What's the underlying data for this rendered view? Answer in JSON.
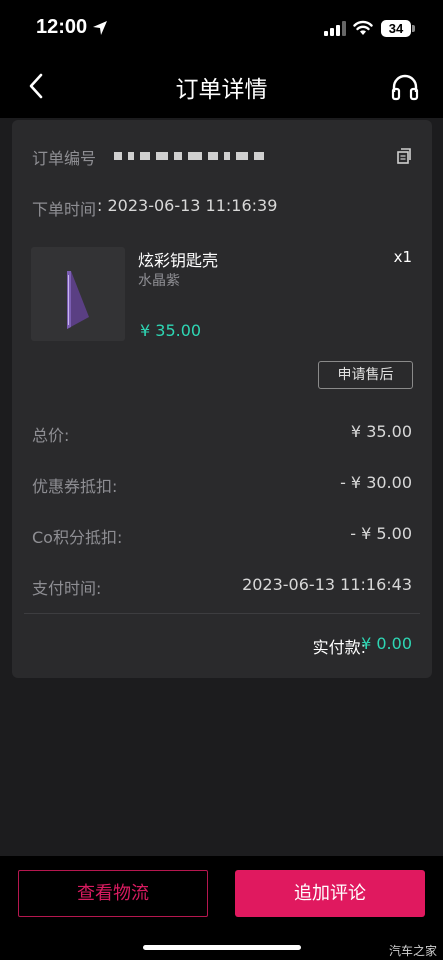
{
  "status_bar": {
    "time": "12:00",
    "battery": "34"
  },
  "nav": {
    "title": "订单详情"
  },
  "order": {
    "number_label": "订单编号",
    "time_label": "下单时间",
    "time_value": ": 2023-06-13 11:16:39"
  },
  "product": {
    "name": "炫彩钥匙壳",
    "variant": "水晶紫",
    "qty": "x1",
    "price": "¥ 35.00",
    "after_sale_label": "申请售后"
  },
  "summary": {
    "rows": [
      {
        "label": "总价:",
        "value": "¥ 35.00"
      },
      {
        "label": "优惠券抵扣:",
        "value": "- ¥ 30.00"
      },
      {
        "label": "Co积分抵扣:",
        "value": "- ¥ 5.00"
      },
      {
        "label": "支付时间:",
        "value": "2023-06-13 11:16:43"
      }
    ],
    "paid_label": "实付款:",
    "paid_value": "¥ 0.00"
  },
  "actions": {
    "logistics": "查看物流",
    "review": "追加评论"
  },
  "watermark": "汽车之家",
  "colors": {
    "accent_pink": "#e0195f",
    "accent_teal": "#2ed6b4"
  }
}
